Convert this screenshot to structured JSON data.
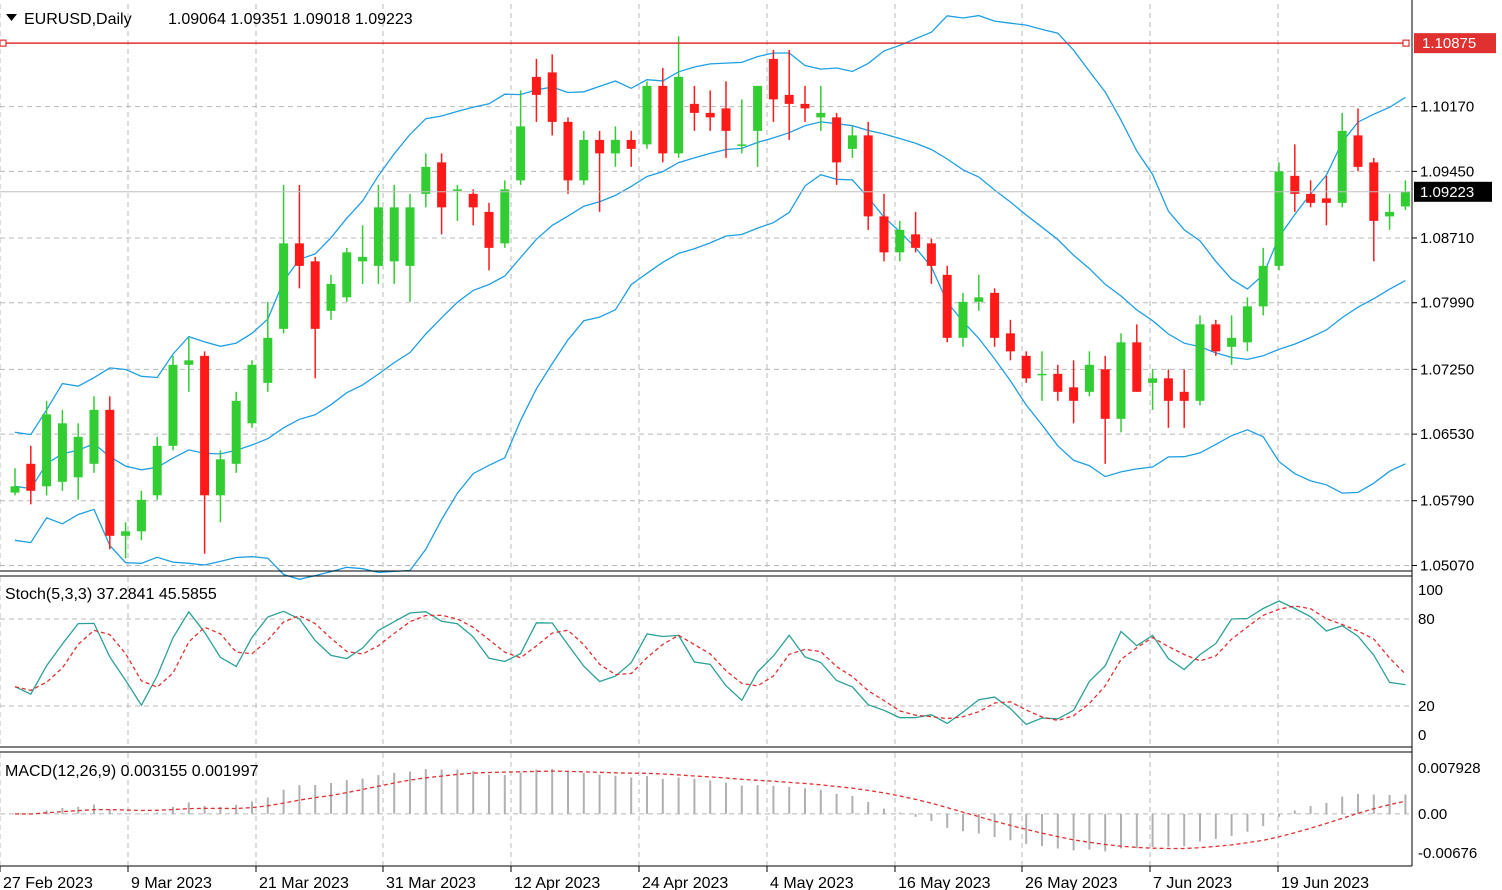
{
  "header": {
    "menu_icon": "triangle-down-icon",
    "symbol": "EURUSD,Daily",
    "ohlc": "1.09064 1.09351 1.09018 1.09223"
  },
  "colors": {
    "bull": "#32cd32",
    "bear": "#ff1a1a",
    "band": "#1e9fe3",
    "grid": "#b8b8b8",
    "hline": "#e03030",
    "stoch_main": "#2aa198",
    "stoch_signal": "#e03030",
    "macd_hist": "#b0b0b0",
    "macd_signal": "#e03030",
    "price_tag": "#000000",
    "alert_tag": "#e03030"
  },
  "price_panel": {
    "ticks": [
      "1.10170",
      "1.09450",
      "1.08710",
      "1.07990",
      "1.07250",
      "1.06530",
      "1.05790",
      "1.05070"
    ],
    "current_price": "1.09223",
    "hline_price": "1.10875"
  },
  "stoch_panel": {
    "title": "Stoch(5,3,3) 37.2841 45.5855",
    "ticks": [
      "100",
      "80",
      "20",
      "0"
    ]
  },
  "macd_panel": {
    "title": "MACD(12,26,9) 0.003155 0.001997",
    "ticks": [
      "0.007928",
      "0.00",
      "-0.00676"
    ]
  },
  "dates": [
    "27 Feb 2023",
    "9 Mar 2023",
    "21 Mar 2023",
    "31 Mar 2023",
    "12 Apr 2023",
    "24 Apr 2023",
    "4 May 2023",
    "16 May 2023",
    "26 May 2023",
    "7 Jun 2023",
    "19 Jun 2023"
  ],
  "chart_data": {
    "type": "candlestick",
    "symbol": "EURUSD",
    "timeframe": "Daily",
    "ylim": [
      1.0502,
      1.1131
    ],
    "candles": [
      [
        1.0588,
        1.0615,
        1.0585,
        1.0595
      ],
      [
        1.062,
        1.064,
        1.0575,
        1.059
      ],
      [
        1.0595,
        1.069,
        1.0585,
        1.0675
      ],
      [
        1.06,
        1.068,
        1.059,
        1.0665
      ],
      [
        1.0605,
        1.0665,
        1.058,
        1.065
      ],
      [
        1.062,
        1.0695,
        1.061,
        1.068
      ],
      [
        1.068,
        1.0695,
        1.0525,
        1.054
      ],
      [
        1.054,
        1.0555,
        1.0515,
        1.0545
      ],
      [
        1.0545,
        1.059,
        1.0535,
        1.058
      ],
      [
        1.0585,
        1.065,
        1.058,
        1.064
      ],
      [
        1.064,
        1.074,
        1.0635,
        1.073
      ],
      [
        1.073,
        1.076,
        1.07,
        1.0735
      ],
      [
        1.074,
        1.0745,
        1.052,
        1.0585
      ],
      [
        1.0585,
        1.0635,
        1.0555,
        1.0625
      ],
      [
        1.062,
        1.07,
        1.061,
        1.069
      ],
      [
        1.0665,
        1.0735,
        1.066,
        1.073
      ],
      [
        1.071,
        1.08,
        1.07,
        1.076
      ],
      [
        1.077,
        1.093,
        1.0765,
        1.0865
      ],
      [
        1.0865,
        1.093,
        1.0815,
        1.084
      ],
      [
        1.0845,
        1.085,
        1.0715,
        1.077
      ],
      [
        1.079,
        1.083,
        1.078,
        1.082
      ],
      [
        1.0805,
        1.086,
        1.08,
        1.0855
      ],
      [
        1.0845,
        1.0885,
        1.082,
        1.085
      ],
      [
        1.084,
        1.093,
        1.082,
        1.0905
      ],
      [
        1.0845,
        1.093,
        1.082,
        1.0905
      ],
      [
        1.084,
        1.092,
        1.08,
        1.0905
      ],
      [
        1.092,
        1.0965,
        1.0905,
        1.095
      ],
      [
        1.0955,
        1.0965,
        1.0875,
        1.0905
      ],
      [
        1.0925,
        1.093,
        1.089,
        1.0925
      ],
      [
        1.092,
        1.0925,
        1.0885,
        1.0905
      ],
      [
        1.09,
        1.091,
        1.0835,
        1.086
      ],
      [
        1.0865,
        1.0935,
        1.086,
        1.0925
      ],
      [
        1.0935,
        1.1035,
        1.093,
        1.0995
      ],
      [
        1.105,
        1.107,
        1.1,
        1.103
      ],
      [
        1.1055,
        1.1075,
        1.0985,
        1.1
      ],
      [
        1.1,
        1.1005,
        1.092,
        1.0935
      ],
      [
        1.0935,
        1.099,
        1.093,
        1.098
      ],
      [
        1.098,
        1.099,
        1.09,
        1.0965
      ],
      [
        1.0965,
        1.0995,
        1.095,
        1.098
      ],
      [
        1.098,
        1.099,
        1.095,
        1.097
      ],
      [
        1.0975,
        1.1045,
        1.097,
        1.104
      ],
      [
        1.104,
        1.106,
        1.0955,
        1.0965
      ],
      [
        1.0965,
        1.1095,
        1.096,
        1.105
      ],
      [
        1.102,
        1.104,
        1.099,
        1.101
      ],
      [
        1.101,
        1.1035,
        1.099,
        1.1005
      ],
      [
        1.1015,
        1.1045,
        1.096,
        1.099
      ],
      [
        1.0975,
        1.1025,
        1.0965,
        1.0975
      ],
      [
        1.099,
        1.103,
        1.095,
        1.104
      ],
      [
        1.107,
        1.108,
        1.1,
        1.1025
      ],
      [
        1.103,
        1.108,
        1.098,
        1.102
      ],
      [
        1.102,
        1.104,
        1.1,
        1.1015
      ],
      [
        1.1005,
        1.104,
        1.099,
        1.101
      ],
      [
        1.1005,
        1.101,
        1.093,
        1.0955
      ],
      [
        1.097,
        1.0995,
        1.096,
        1.0985
      ],
      [
        1.0985,
        1.1,
        1.088,
        1.0895
      ],
      [
        1.0895,
        1.092,
        1.0845,
        1.0855
      ],
      [
        1.0855,
        1.089,
        1.0845,
        1.088
      ],
      [
        1.0875,
        1.09,
        1.0855,
        1.086
      ],
      [
        1.0865,
        1.087,
        1.082,
        1.084
      ],
      [
        1.083,
        1.084,
        1.0755,
        1.076
      ],
      [
        1.076,
        1.081,
        1.075,
        1.08
      ],
      [
        1.08,
        1.083,
        1.079,
        1.0805
      ],
      [
        1.081,
        1.0815,
        1.075,
        1.076
      ],
      [
        1.0765,
        1.078,
        1.0735,
        1.0745
      ],
      [
        1.074,
        1.0745,
        1.071,
        1.0715
      ],
      [
        1.072,
        1.0745,
        1.069,
        1.072
      ],
      [
        1.072,
        1.073,
        1.069,
        1.07
      ],
      [
        1.0705,
        1.0735,
        1.0665,
        1.069
      ],
      [
        1.07,
        1.0745,
        1.0695,
        1.073
      ],
      [
        1.0725,
        1.074,
        1.062,
        1.067
      ],
      [
        1.067,
        1.0765,
        1.0655,
        1.0755
      ],
      [
        1.0755,
        1.0775,
        1.07,
        1.07
      ],
      [
        1.071,
        1.0725,
        1.068,
        1.0715
      ],
      [
        1.0715,
        1.0725,
        1.066,
        1.069
      ],
      [
        1.07,
        1.0725,
        1.066,
        1.069
      ],
      [
        1.069,
        1.0785,
        1.0685,
        1.0775
      ],
      [
        1.0775,
        1.078,
        1.074,
        1.0745
      ],
      [
        1.075,
        1.0785,
        1.073,
        1.076
      ],
      [
        1.0755,
        1.0805,
        1.0745,
        1.0795
      ],
      [
        1.0795,
        1.086,
        1.0785,
        1.084
      ],
      [
        1.084,
        1.0955,
        1.0835,
        1.0945
      ],
      [
        1.094,
        1.0975,
        1.09,
        1.092
      ],
      [
        1.092,
        1.0935,
        1.0905,
        1.091
      ],
      [
        1.0915,
        1.094,
        1.0885,
        1.091
      ],
      [
        1.091,
        1.101,
        1.0905,
        1.099
      ],
      [
        1.0985,
        1.1015,
        1.0945,
        1.095
      ],
      [
        1.0955,
        1.096,
        1.0845,
        1.089
      ],
      [
        1.0895,
        1.092,
        1.088,
        1.09
      ],
      [
        1.0906,
        1.0935,
        1.0902,
        1.0922
      ]
    ],
    "bands": {
      "period": 20,
      "deviation": 2
    },
    "horizontal_line": 1.10875,
    "last_price": 1.09223,
    "stochastic": {
      "params": [
        5,
        3,
        3
      ],
      "main_last": 37.2841,
      "signal_last": 45.5855,
      "ylim": [
        0,
        100
      ],
      "levels": [
        20,
        80
      ]
    },
    "macd": {
      "params": [
        12,
        26,
        9
      ],
      "main_last": 0.003155,
      "signal_last": 0.001997,
      "ylim": [
        -0.00676,
        0.007928
      ]
    }
  }
}
